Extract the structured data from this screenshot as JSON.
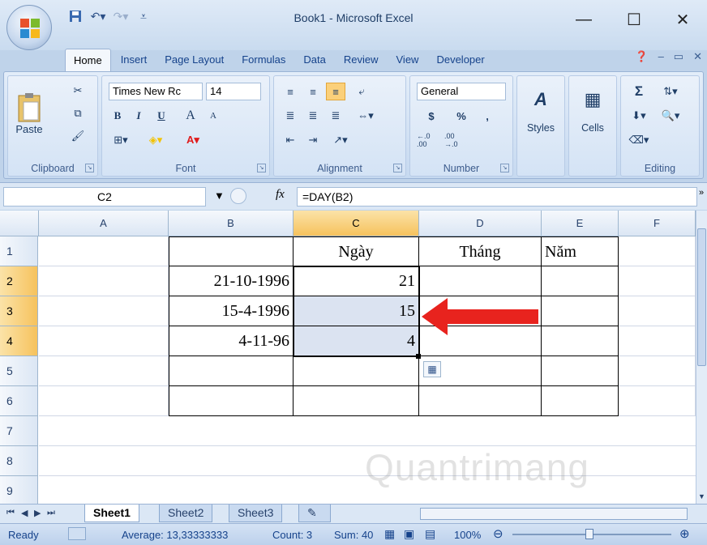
{
  "window": {
    "title": "Book1 - Microsoft Excel",
    "minimize": "—",
    "maximize": "☐",
    "close": "✕"
  },
  "tabs": [
    "Home",
    "Insert",
    "Page Layout",
    "Formulas",
    "Data",
    "Review",
    "View",
    "Developer"
  ],
  "ribbon": {
    "clipboard": {
      "label": "Clipboard",
      "paste": "Paste"
    },
    "font": {
      "label": "Font",
      "name": "Times New Rc",
      "size": "14",
      "bold": "B",
      "italic": "I",
      "underline": "U",
      "grow": "A",
      "shrink": "A"
    },
    "alignment": {
      "label": "Alignment"
    },
    "number": {
      "label": "Number",
      "format": "General",
      "currency": "$",
      "percent": "%",
      "comma": ",",
      "inc_decimal": "←.0 .00",
      "dec_decimal": ".00 →.0"
    },
    "styles": {
      "label": "Styles"
    },
    "cells": {
      "label": "Cells"
    },
    "editing": {
      "label": "Editing",
      "sum": "Σ"
    }
  },
  "formula_bar": {
    "name_box": "C2",
    "fx": "fx",
    "formula": "=DAY(B2)"
  },
  "columns": [
    "A",
    "B",
    "C",
    "D",
    "E",
    "F"
  ],
  "rows": [
    "1",
    "2",
    "3",
    "4",
    "5",
    "6",
    "7",
    "8",
    "9"
  ],
  "cells": {
    "C1": "Ngày",
    "D1": "Tháng",
    "E1": "Năm",
    "B2": "21-10-1996",
    "C2": "21",
    "B3": "15-4-1996",
    "C3": "15",
    "B4": "4-11-96",
    "C4": "4"
  },
  "sheets": [
    "Sheet1",
    "Sheet2",
    "Sheet3"
  ],
  "status": {
    "ready": "Ready",
    "average": "Average: 13,33333333",
    "count": "Count: 3",
    "sum": "Sum: 40",
    "zoom": "100%"
  },
  "colors": {
    "selection": "#dbe3f1",
    "arrow": "#e8231e",
    "active_header": "#f6c25d"
  },
  "watermark": "Quantrimang"
}
